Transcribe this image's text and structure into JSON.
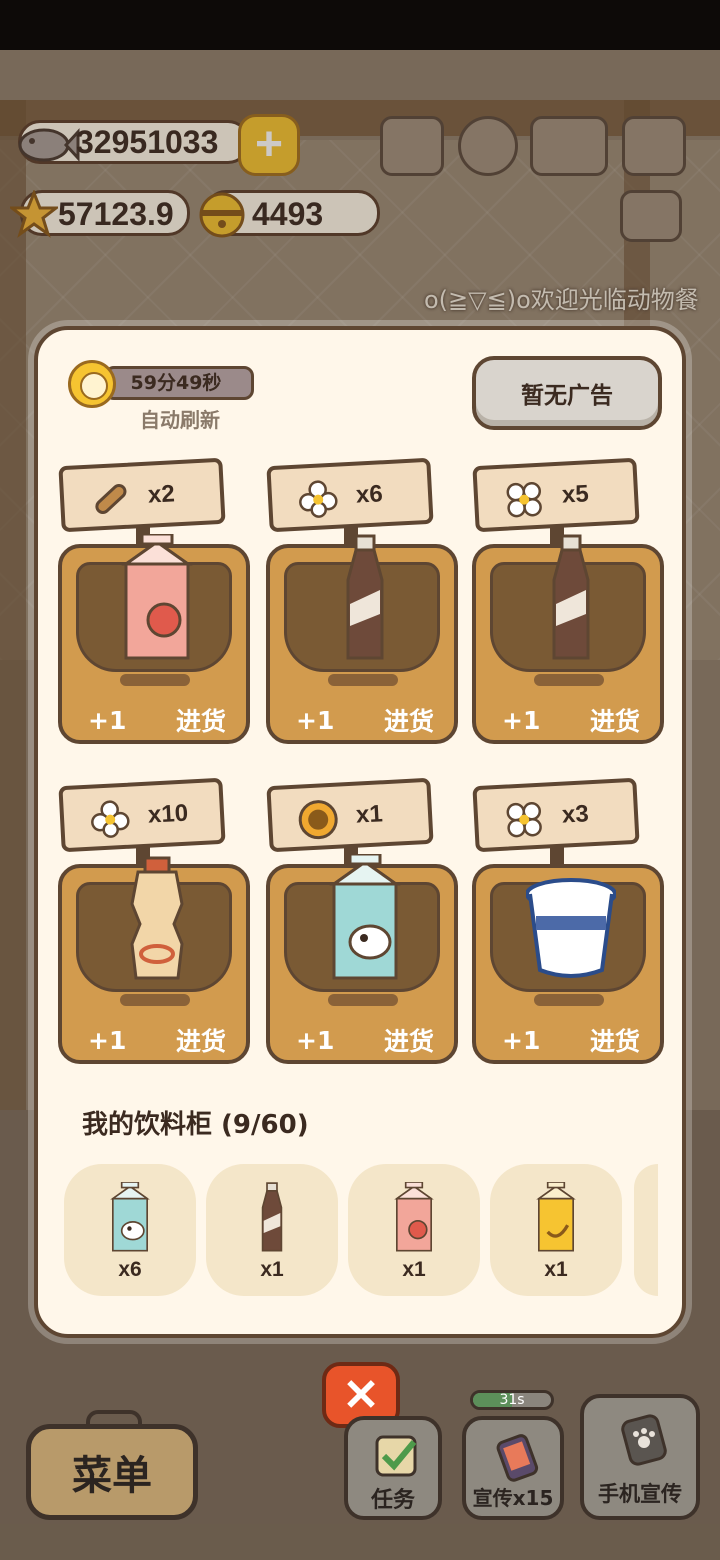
{
  "hud": {
    "fish": "32951033",
    "stars": "57123.9",
    "bells": "4493",
    "welcome_ticker": "o(≧▽≦)o欢迎光临动物餐"
  },
  "shop": {
    "timer": "59分49秒",
    "refresh_label": "自动刷新",
    "no_ad_label": "暂无广告",
    "items": [
      {
        "cost_icon": "wood-log-icon",
        "cost_qty": "x2",
        "product": "strawberry-milk",
        "plus": "+1",
        "action": "进货"
      },
      {
        "cost_icon": "flower-icon",
        "cost_qty": "x6",
        "product": "cola-bottle",
        "plus": "+1",
        "action": "进货"
      },
      {
        "cost_icon": "flower-bunch-icon",
        "cost_qty": "x5",
        "product": "cola-bottle",
        "plus": "+1",
        "action": "进货"
      },
      {
        "cost_icon": "flower-icon",
        "cost_qty": "x10",
        "product": "yakult-bottle",
        "plus": "+1",
        "action": "进货"
      },
      {
        "cost_icon": "sunflower-icon",
        "cost_qty": "x1",
        "product": "cow-milk-carton",
        "plus": "+1",
        "action": "进货"
      },
      {
        "cost_icon": "flower-bunch-icon",
        "cost_qty": "x3",
        "product": "yogurt-cup",
        "plus": "+1",
        "action": "进货"
      }
    ]
  },
  "cabinet": {
    "title": "我的饮料柜 (9/60)",
    "slots": [
      {
        "product": "cow-milk-carton",
        "qty": "x6"
      },
      {
        "product": "cola-bottle",
        "qty": "x1"
      },
      {
        "product": "strawberry-milk",
        "qty": "x1"
      },
      {
        "product": "banana-milk",
        "qty": "x1"
      }
    ]
  },
  "bottom_bar": {
    "menu": "菜单",
    "task": "任务",
    "promo": "宣传x15",
    "promo_cooldown": "31s",
    "promo_cooldown_fraction": 0.5,
    "phone_promo": "手机宣传"
  },
  "colors": {
    "panel_bg": "#fff7ea",
    "crate": "#d29b4e",
    "close": "#e8542a",
    "gold": "#f6c431"
  }
}
